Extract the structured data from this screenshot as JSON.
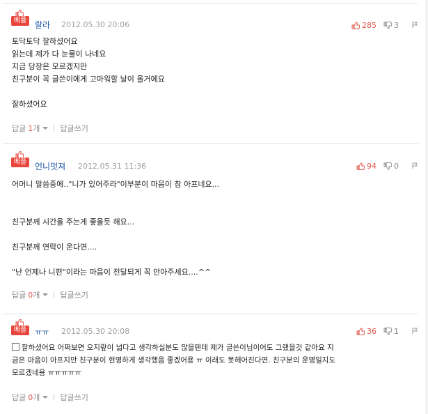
{
  "best_label": "베플",
  "reply_label": "답글",
  "count_suffix": "개",
  "write_reply_label": "답글쓰기",
  "colors": {
    "best": "#e8453c",
    "nick": "#1c56a6",
    "up": "#e2544b",
    "muted": "#a0a0a0"
  },
  "comments": [
    {
      "nickname": "랄라",
      "date": "2012.05.30 20:06",
      "up": "285",
      "down": "3",
      "lines": [
        "토닥토닥 잘하셨어요",
        "읽는데 제가 다 눈물이 나네요",
        "지금 당장은 모르겠지만",
        "친구분이 꼭 글쓴이에게 고마워할 날이 올거에요",
        "",
        "잘하셨어요"
      ],
      "reply_count": "1"
    },
    {
      "nickname": "언니멋져",
      "date": "2012.05.31 11:36",
      "up": "94",
      "down": "0",
      "lines": [
        "어머니 말씀중에..\"니가 있어주라\"이부분이 마음이 참 아프네요...",
        "",
        "",
        "친구분께 시간을 주는게 좋을듯 해요...",
        "",
        "친구분께 연락이 온다면....",
        "",
        "\"난 언제나 니편\"이라는 마음이 전달되게 꼭 안아주세요....^^"
      ],
      "reply_count": "0"
    },
    {
      "nickname": "ㅠㅠ",
      "date": "2012.05.30 20:08",
      "up": "36",
      "down": "1",
      "lines": [
        "잘하셨어요 어쩌보면 오지랖이 넓다고 생각하실분도 많을텐데 제가 글쓴이님이어도 그랬을것 같아요 지",
        "금은 마음이 아프지만 친구분이 현명하게 생각했음 좋겠어용 ㅠ 이래도 못헤어진다면. 친구분의 운명일지도",
        "모르겠네용 ㅠㅠㅠㅠㅠ"
      ],
      "reply_count": "0"
    }
  ]
}
